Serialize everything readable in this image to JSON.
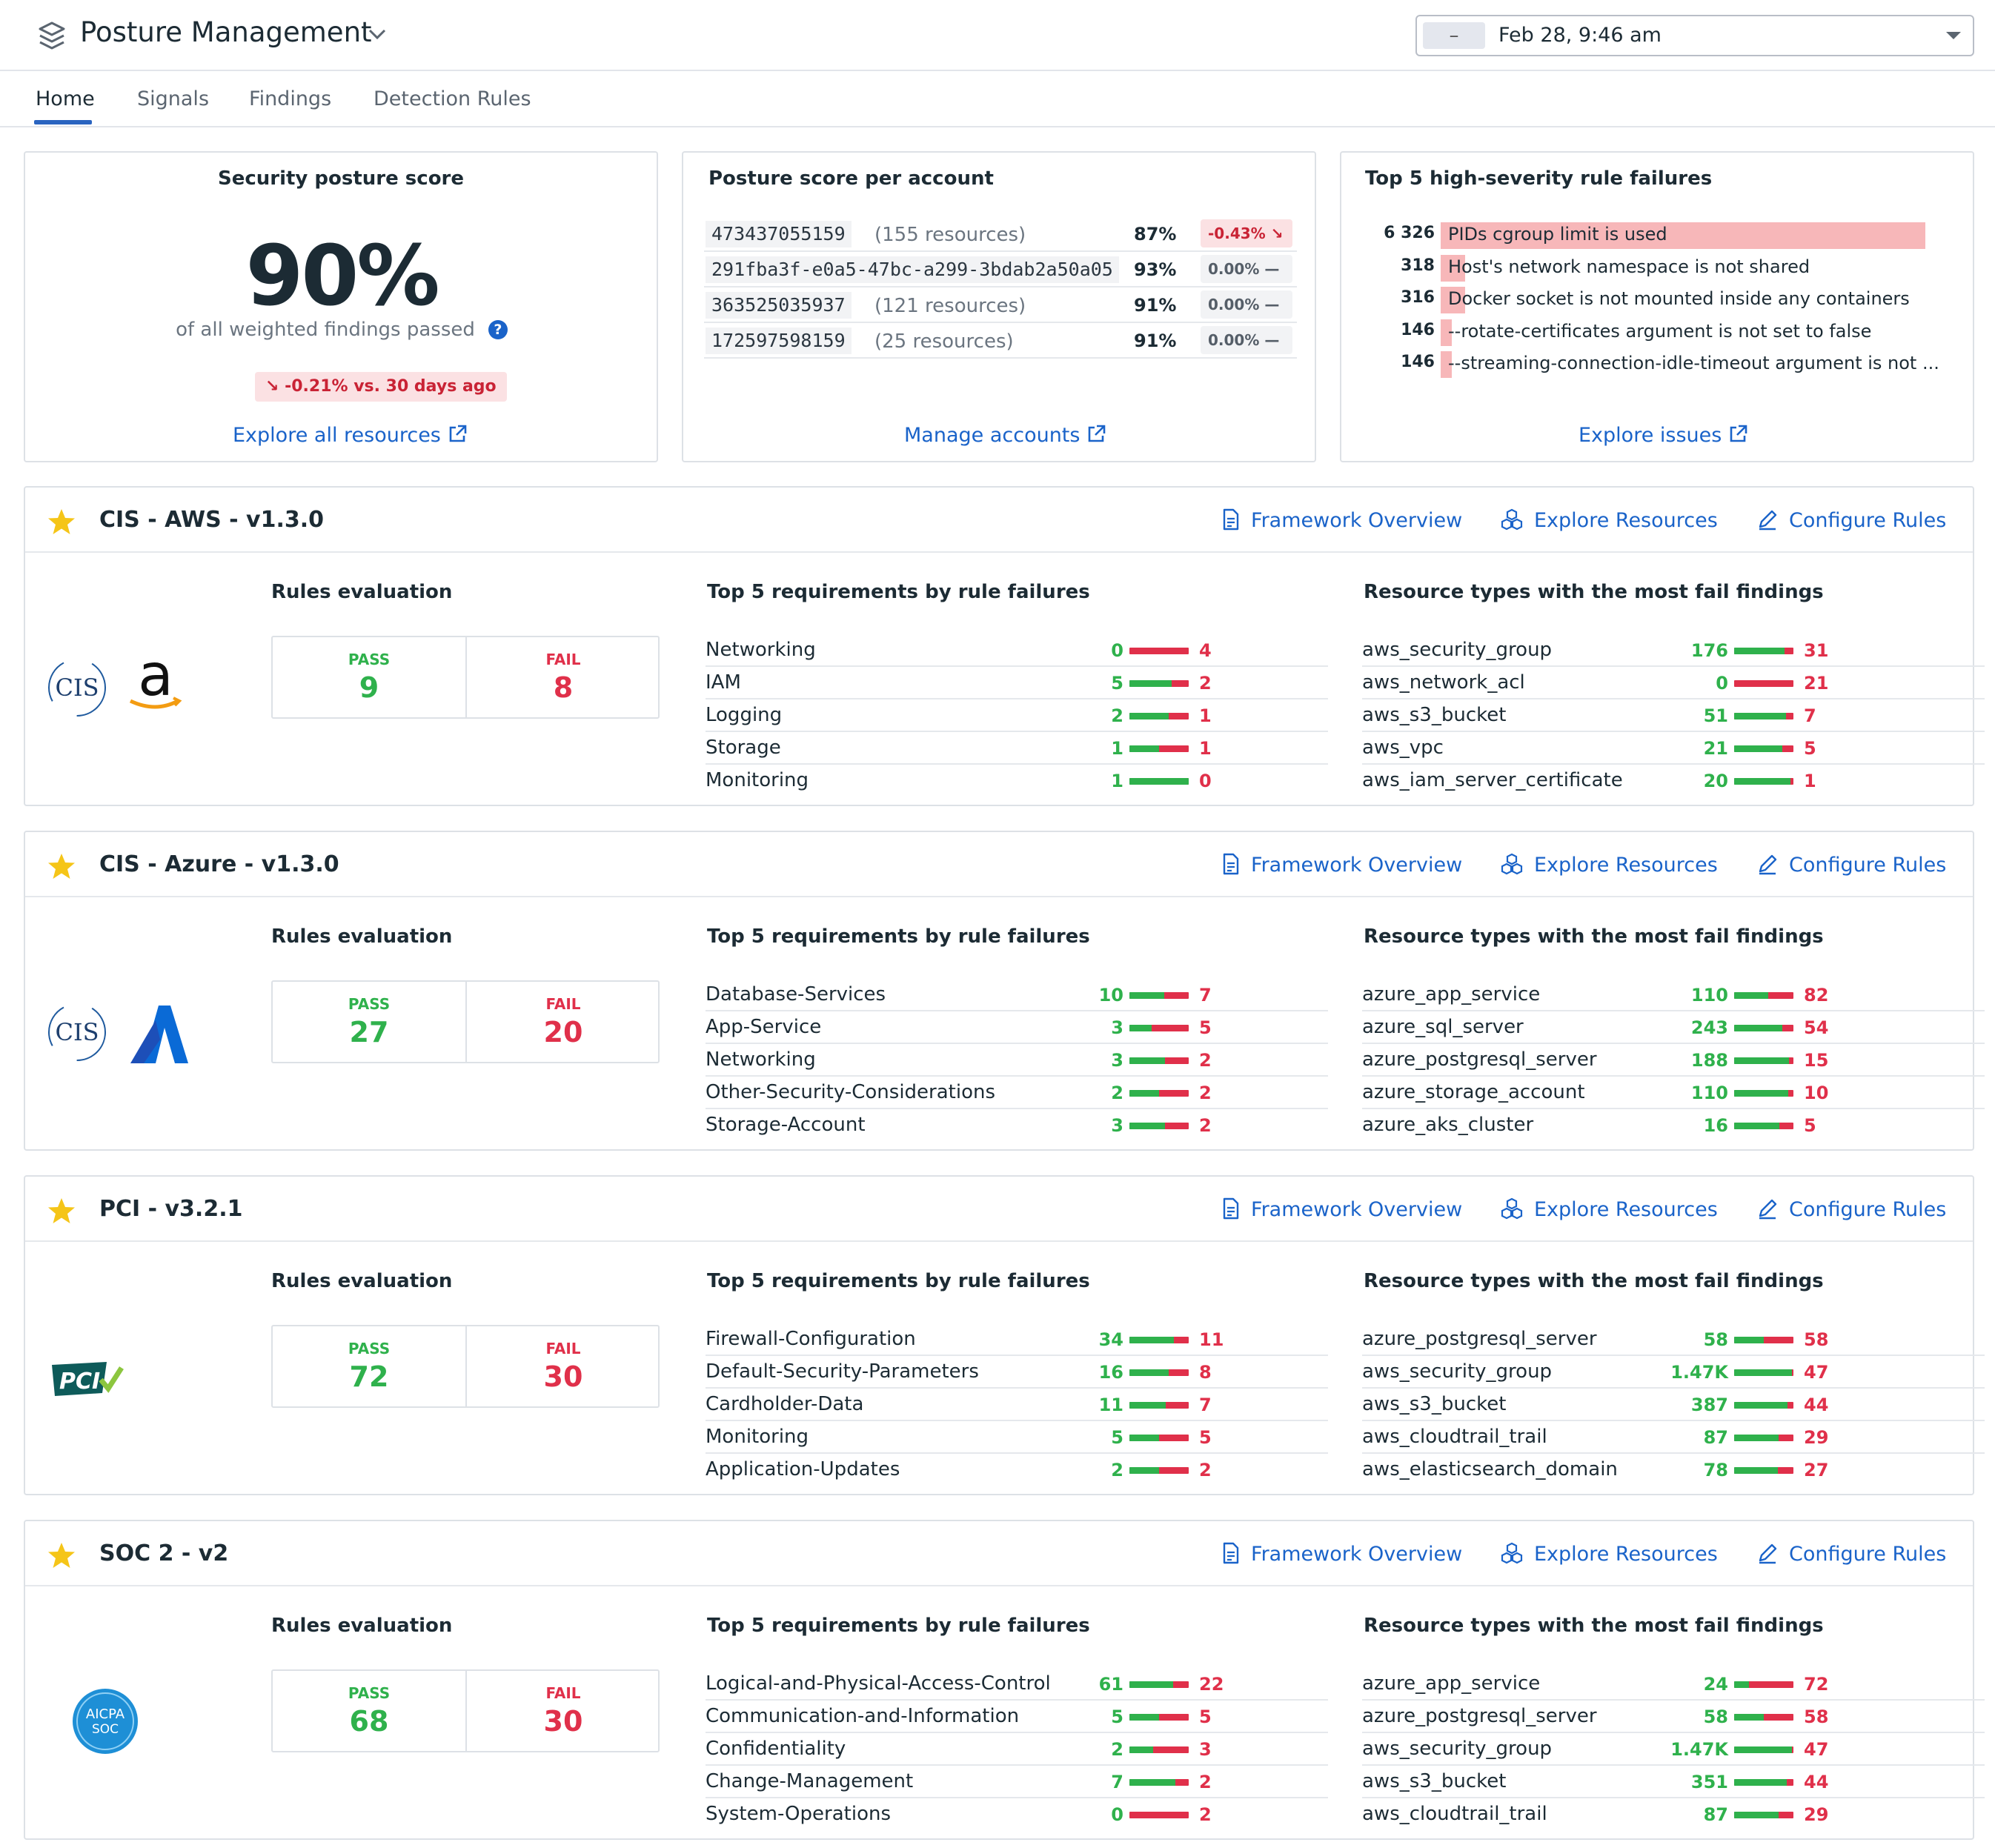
{
  "header": {
    "title": "Posture Management",
    "time_minus": "–",
    "time_label": "Feb 28, 9:46 am"
  },
  "tabs": [
    {
      "label": "Home",
      "active": true
    },
    {
      "label": "Signals"
    },
    {
      "label": "Findings"
    },
    {
      "label": "Detection Rules"
    }
  ],
  "score_card": {
    "title": "Security posture score",
    "score": "90%",
    "subtitle": "of all weighted findings passed",
    "help": "?",
    "delta": "↘ -0.21% vs. 30 days ago",
    "link": "Explore all resources"
  },
  "accounts_card": {
    "title": "Posture score per account",
    "rows": [
      {
        "id": "473437055159",
        "resources": "(155 resources)",
        "pct": "87%",
        "delta": "-0.43% ↘",
        "trend": "down"
      },
      {
        "id": "291fba3f-e0a5-47bc-a299-3bdab2a50a05",
        "resources": "",
        "pct": "93%",
        "delta": "0.00% —",
        "trend": "flat"
      },
      {
        "id": "363525035937",
        "resources": "(121 resources)",
        "pct": "91%",
        "delta": "0.00% —",
        "trend": "flat"
      },
      {
        "id": "172597598159",
        "resources": "(25 resources)",
        "pct": "91%",
        "delta": "0.00% —",
        "trend": "flat"
      }
    ],
    "link": "Manage accounts"
  },
  "failures_card": {
    "title": "Top 5 high-severity rule failures",
    "rows": [
      {
        "count": "6 326",
        "value": 6326,
        "label": "PIDs cgroup limit is used"
      },
      {
        "count": "318",
        "value": 318,
        "label": "Host's network namespace is not shared"
      },
      {
        "count": "316",
        "value": 316,
        "label": "Docker socket is not mounted inside any containers"
      },
      {
        "count": "146",
        "value": 146,
        "label": "--rotate-certificates argument is not set to false"
      },
      {
        "count": "146",
        "value": 146,
        "label": "--streaming-connection-idle-timeout argument is not ..."
      }
    ],
    "link": "Explore issues"
  },
  "labels": {
    "framework_overview": "Framework Overview",
    "explore_resources": "Explore Resources",
    "configure_rules": "Configure Rules",
    "rules_evaluation": "Rules evaluation",
    "top_requirements": "Top 5 requirements by rule failures",
    "resource_types": "Resource types with the most fail findings",
    "pass": "PASS",
    "fail": "FAIL"
  },
  "frameworks": [
    {
      "name": "CIS - AWS - v1.3.0",
      "logo": "cis-aws-logo",
      "logo_text": "CIS",
      "pass": "9",
      "fail": "8",
      "requirements": [
        {
          "name": "Networking",
          "pass": "0",
          "fail": "4",
          "p": 0,
          "f": 4
        },
        {
          "name": "IAM",
          "pass": "5",
          "fail": "2",
          "p": 5,
          "f": 2
        },
        {
          "name": "Logging",
          "pass": "2",
          "fail": "1",
          "p": 2,
          "f": 1
        },
        {
          "name": "Storage",
          "pass": "1",
          "fail": "1",
          "p": 1,
          "f": 1
        },
        {
          "name": "Monitoring",
          "pass": "1",
          "fail": "0",
          "p": 1,
          "f": 0
        }
      ],
      "resources": [
        {
          "name": "aws_security_group",
          "pass": "176",
          "fail": "31",
          "p": 176,
          "f": 31
        },
        {
          "name": "aws_network_acl",
          "pass": "0",
          "fail": "21",
          "p": 0,
          "f": 21
        },
        {
          "name": "aws_s3_bucket",
          "pass": "51",
          "fail": "7",
          "p": 51,
          "f": 7
        },
        {
          "name": "aws_vpc",
          "pass": "21",
          "fail": "5",
          "p": 21,
          "f": 5
        },
        {
          "name": "aws_iam_server_certificate",
          "pass": "20",
          "fail": "1",
          "p": 20,
          "f": 1
        }
      ]
    },
    {
      "name": "CIS - Azure - v1.3.0",
      "logo": "cis-azure-logo",
      "logo_text": "CIS",
      "pass": "27",
      "fail": "20",
      "requirements": [
        {
          "name": "Database-Services",
          "pass": "10",
          "fail": "7",
          "p": 10,
          "f": 7
        },
        {
          "name": "App-Service",
          "pass": "3",
          "fail": "5",
          "p": 3,
          "f": 5
        },
        {
          "name": "Networking",
          "pass": "3",
          "fail": "2",
          "p": 3,
          "f": 2
        },
        {
          "name": "Other-Security-Considerations",
          "pass": "2",
          "fail": "2",
          "p": 2,
          "f": 2
        },
        {
          "name": "Storage-Account",
          "pass": "3",
          "fail": "2",
          "p": 3,
          "f": 2
        }
      ],
      "resources": [
        {
          "name": "azure_app_service",
          "pass": "110",
          "fail": "82",
          "p": 110,
          "f": 82
        },
        {
          "name": "azure_sql_server",
          "pass": "243",
          "fail": "54",
          "p": 243,
          "f": 54
        },
        {
          "name": "azure_postgresql_server",
          "pass": "188",
          "fail": "15",
          "p": 188,
          "f": 15
        },
        {
          "name": "azure_storage_account",
          "pass": "110",
          "fail": "10",
          "p": 110,
          "f": 10
        },
        {
          "name": "azure_aks_cluster",
          "pass": "16",
          "fail": "5",
          "p": 16,
          "f": 5
        }
      ]
    },
    {
      "name": "PCI - v3.2.1",
      "logo": "pci-logo",
      "logo_text": "PCI",
      "pass": "72",
      "fail": "30",
      "requirements": [
        {
          "name": "Firewall-Configuration",
          "pass": "34",
          "fail": "11",
          "p": 34,
          "f": 11
        },
        {
          "name": "Default-Security-Parameters",
          "pass": "16",
          "fail": "8",
          "p": 16,
          "f": 8
        },
        {
          "name": "Cardholder-Data",
          "pass": "11",
          "fail": "7",
          "p": 11,
          "f": 7
        },
        {
          "name": "Monitoring",
          "pass": "5",
          "fail": "5",
          "p": 5,
          "f": 5
        },
        {
          "name": "Application-Updates",
          "pass": "2",
          "fail": "2",
          "p": 2,
          "f": 2
        }
      ],
      "resources": [
        {
          "name": "azure_postgresql_server",
          "pass": "58",
          "fail": "58",
          "p": 58,
          "f": 58
        },
        {
          "name": "aws_security_group",
          "pass": "1.47K",
          "fail": "47",
          "p": 1470,
          "f": 47
        },
        {
          "name": "aws_s3_bucket",
          "pass": "387",
          "fail": "44",
          "p": 387,
          "f": 44
        },
        {
          "name": "aws_cloudtrail_trail",
          "pass": "87",
          "fail": "29",
          "p": 87,
          "f": 29
        },
        {
          "name": "aws_elasticsearch_domain",
          "pass": "78",
          "fail": "27",
          "p": 78,
          "f": 27
        }
      ]
    },
    {
      "name": "SOC 2 - v2",
      "logo": "aicpa-soc-logo",
      "logo_text": "AICPA SOC",
      "pass": "68",
      "fail": "30",
      "requirements": [
        {
          "name": "Logical-and-Physical-Access-Control",
          "pass": "61",
          "fail": "22",
          "p": 61,
          "f": 22
        },
        {
          "name": "Communication-and-Information",
          "pass": "5",
          "fail": "5",
          "p": 5,
          "f": 5
        },
        {
          "name": "Confidentiality",
          "pass": "2",
          "fail": "3",
          "p": 2,
          "f": 3
        },
        {
          "name": "Change-Management",
          "pass": "7",
          "fail": "2",
          "p": 7,
          "f": 2
        },
        {
          "name": "System-Operations",
          "pass": "0",
          "fail": "2",
          "p": 0,
          "f": 2
        }
      ],
      "resources": [
        {
          "name": "azure_app_service",
          "pass": "24",
          "fail": "72",
          "p": 24,
          "f": 72
        },
        {
          "name": "azure_postgresql_server",
          "pass": "58",
          "fail": "58",
          "p": 58,
          "f": 58
        },
        {
          "name": "aws_security_group",
          "pass": "1.47K",
          "fail": "47",
          "p": 1470,
          "f": 47
        },
        {
          "name": "aws_s3_bucket",
          "pass": "351",
          "fail": "44",
          "p": 351,
          "f": 44
        },
        {
          "name": "aws_cloudtrail_trail",
          "pass": "87",
          "fail": "29",
          "p": 87,
          "f": 29
        }
      ]
    }
  ],
  "colors": {
    "accent": "#1a63c9",
    "pass": "#2fb14c",
    "fail": "#e0304a",
    "star": "#f5c518",
    "fail_bar": "#f7b7b9"
  }
}
